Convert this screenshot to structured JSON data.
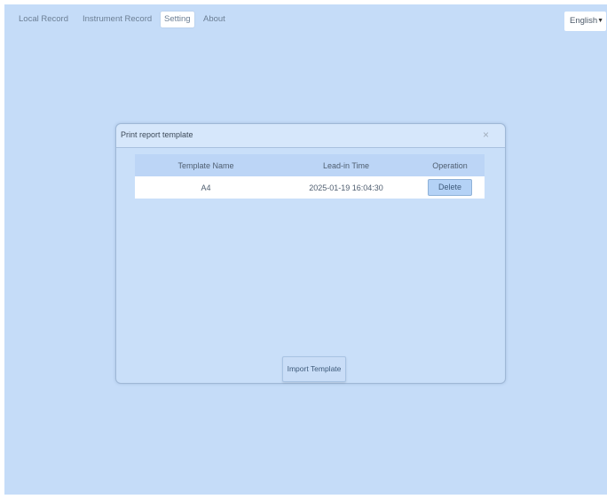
{
  "nav": {
    "items": [
      {
        "label": "Local Record"
      },
      {
        "label": "Instrument Record"
      },
      {
        "label": "Setting"
      },
      {
        "label": "About"
      }
    ],
    "active": "Setting"
  },
  "language": {
    "selected": "English",
    "caret_icon": "chevron-down-icon"
  },
  "dialog": {
    "title": "Print report template",
    "close_icon": "close-icon",
    "close_glyph": "×",
    "table": {
      "columns": [
        "Template Name",
        "Lead-in Time",
        "Operation"
      ],
      "rows": [
        {
          "name": "A4",
          "time": "2025-01-19 16:04:30",
          "action": "Delete"
        }
      ]
    },
    "import_label": "Import Template"
  },
  "colors": {
    "background": "#c5dcf8",
    "header_row": "#bcd5f6",
    "button": "#b4d2f6"
  }
}
